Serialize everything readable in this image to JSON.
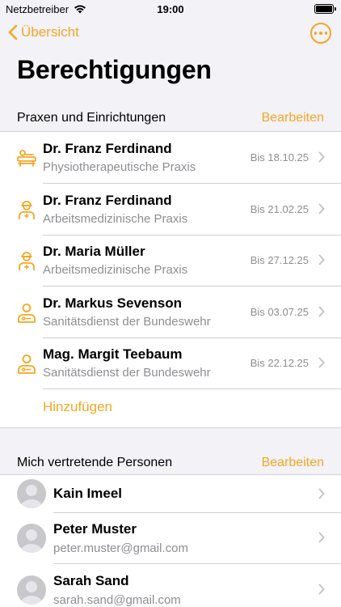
{
  "status_bar": {
    "carrier": "Netzbetreiber",
    "time": "19:00"
  },
  "nav": {
    "back_label": "Übersicht"
  },
  "page": {
    "title": "Berechtigungen"
  },
  "section_practices": {
    "title": "Praxen und Einrichtungen",
    "edit_label": "Bearbeiten",
    "items": [
      {
        "name": "Dr. Franz Ferdinand",
        "type": "Physiotherapeutische Praxis",
        "date": "Bis 18.10.25",
        "icon": "physio-icon"
      },
      {
        "name": "Dr. Franz Ferdinand",
        "type": "Arbeitsmedizinische Praxis",
        "date": "Bis 21.02.25",
        "icon": "occupational-doctor-icon"
      },
      {
        "name": "Dr. Maria Müller",
        "type": "Arbeitsmedizinische Praxis",
        "date": "Bis 27.12.25",
        "icon": "occupational-doctor-icon"
      },
      {
        "name": "Dr. Markus Sevenson",
        "type": "Sanitätsdienst der Bundeswehr",
        "date": "Bis 03.07.25",
        "icon": "medic-service-icon"
      },
      {
        "name": "Mag. Margit Teebaum",
        "type": "Sanitätsdienst der Bundeswehr",
        "date": "Bis 22.12.25",
        "icon": "medic-service-icon"
      }
    ],
    "add_label": "Hinzufügen"
  },
  "section_representatives": {
    "title": "Mich vertretende Personen",
    "edit_label": "Bearbeiten",
    "items": [
      {
        "name": "Kain Imeel",
        "email": ""
      },
      {
        "name": "Peter Muster",
        "email": "peter.muster@gmail.com"
      },
      {
        "name": "Sarah Sand",
        "email": "sarah.sand@gmail.com"
      }
    ]
  },
  "colors": {
    "accent": "#f5a623",
    "secondary_text": "#8e8e93",
    "background": "#f2f2f7"
  }
}
